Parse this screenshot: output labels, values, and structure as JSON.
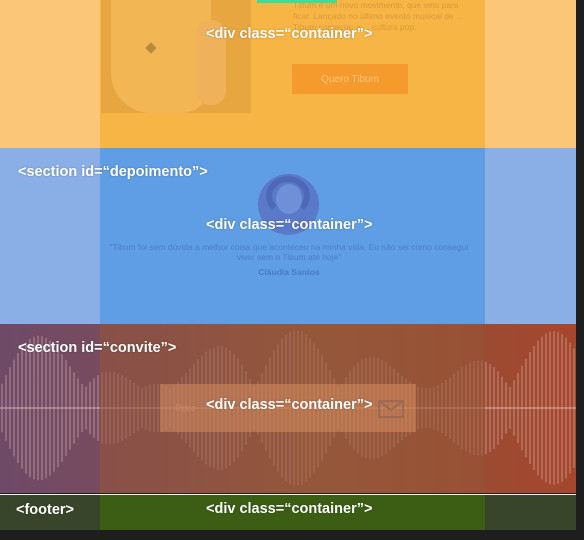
{
  "labels": {
    "container": "<div class=“container”>",
    "depoimento": "<section id=“depoimento”>",
    "convite": "<section id=“convite”>",
    "footer": "<footer>"
  },
  "hero": {
    "paragraph": "Tibum é um novo movimento, que veio para ficar. Lançado no último evento musical de ... Tibum começou a ... cultura pop.",
    "cta_label": "Quero Tibum"
  },
  "depoimento": {
    "quote": "\"Tibum foi sem dúvida a melhor coisa que aconteceu na minha vida. Eu não sei como conseguí viver sem o Tibum até hoje\"",
    "author": "Cláudia Santos"
  },
  "convite": {
    "form_text": "Rece"
  },
  "colors": {
    "hero_section": "#fbc677",
    "hero_container": "#f7b545",
    "depoimento_section": "#8aaee6",
    "depoimento_container": "#5f9de4",
    "footer_section": "#38452a",
    "footer_container": "#3b5e14",
    "accent_bar": "#3ddc97"
  },
  "icons": {
    "mail": "envelope-icon"
  }
}
